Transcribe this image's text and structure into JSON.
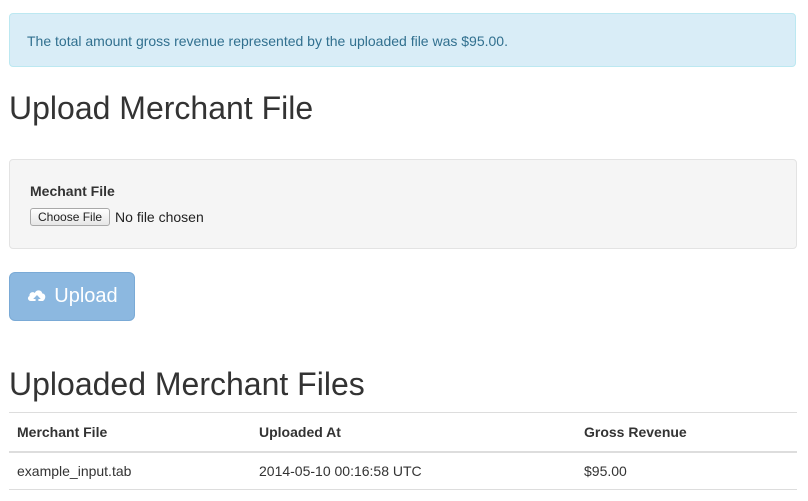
{
  "alert": {
    "message": "The total amount gross revenue represented by the uploaded file was $95.00."
  },
  "upload_section": {
    "title": "Upload Merchant File",
    "field_label": "Mechant File",
    "choose_button_label": "Choose File",
    "file_status": "No file chosen",
    "upload_button_label": "Upload",
    "upload_icon": "cloud-upload-icon"
  },
  "files_section": {
    "title": "Uploaded Merchant Files",
    "columns": [
      "Merchant File",
      "Uploaded At",
      "Gross Revenue"
    ],
    "rows": [
      [
        "example_input.tab",
        "2014-05-10 00:16:58 UTC",
        "$95.00"
      ]
    ]
  },
  "colors": {
    "alert_bg": "#d9edf7",
    "alert_text": "#31708f",
    "primary_button": "#8cb8e0"
  }
}
